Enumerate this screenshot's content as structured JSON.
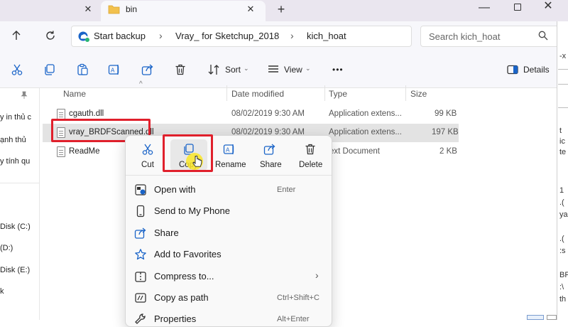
{
  "tabs": {
    "active_title": "bin"
  },
  "address": {
    "crumbs": [
      "Start backup",
      "Vray_ for Sketchup_2018",
      "kich_hoat"
    ],
    "search_placeholder": "Search kich_hoat"
  },
  "toolbar": {
    "sort_label": "Sort",
    "view_label": "View",
    "more_label": "•••",
    "details_label": "Details"
  },
  "nav_pane": {
    "fragments": [
      "y in thủ c",
      "ạnh thủ",
      "y tính qu",
      "Disk (C:)",
      "(D:)",
      "Disk (E:)",
      "k"
    ]
  },
  "columns": {
    "name": "Name",
    "date_modified": "Date modified",
    "type": "Type",
    "size": "Size"
  },
  "files": [
    {
      "name": "cgauth.dll",
      "date": "08/02/2019 9:30 AM",
      "type": "Application extens...",
      "size": "99 KB"
    },
    {
      "name": "vray_BRDFScanned.dll",
      "date": "08/02/2019 9:30 AM",
      "type": "Application extens...",
      "size": "197 KB",
      "selected": true
    },
    {
      "name": "ReadMe",
      "date": "",
      "type": "ext Document",
      "size": "2 KB"
    }
  ],
  "context_menu": {
    "quick_actions": [
      {
        "label": "Cut",
        "icon": "scissors-icon"
      },
      {
        "label": "Copy",
        "icon": "copy-icon"
      },
      {
        "label": "Rename",
        "icon": "rename-icon"
      },
      {
        "label": "Share",
        "icon": "share-icon"
      },
      {
        "label": "Delete",
        "icon": "trash-icon"
      }
    ],
    "items": [
      {
        "label": "Open with",
        "shortcut": "Enter",
        "icon": "open-with-icon"
      },
      {
        "label": "Send to My Phone",
        "shortcut": "",
        "icon": "phone-icon"
      },
      {
        "label": "Share",
        "shortcut": "",
        "icon": "share-icon"
      },
      {
        "label": "Add to Favorites",
        "shortcut": "",
        "icon": "star-icon"
      },
      {
        "label": "Compress to...",
        "shortcut": "",
        "icon": "archive-icon",
        "submenu": true
      },
      {
        "label": "Copy as path",
        "shortcut": "Ctrl+Shift+C",
        "icon": "copy-path-icon"
      },
      {
        "label": "Properties",
        "shortcut": "Alt+Enter",
        "icon": "wrench-icon"
      }
    ]
  },
  "right_window": {
    "fragments": [
      "-x",
      "t",
      "ic",
      "te",
      "1",
      ".(",
      "ya",
      ".(",
      ":s",
      "BF",
      ":\\",
      "th"
    ]
  },
  "colors": {
    "highlight_red": "#e0202c",
    "accent_blue": "#1a64c8",
    "selected_row": "#e3e3e3"
  }
}
